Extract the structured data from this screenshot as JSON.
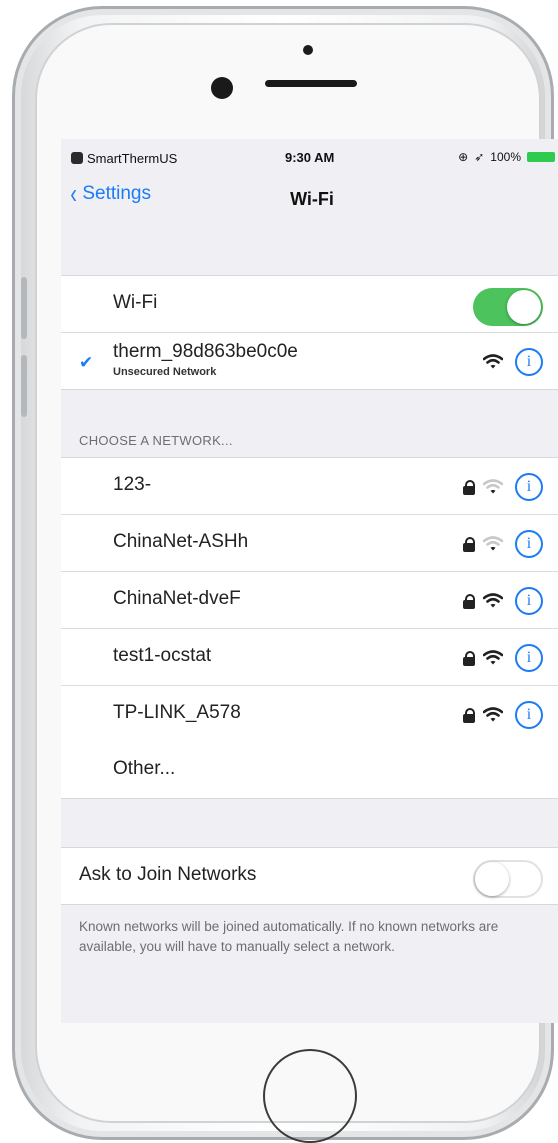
{
  "status_bar": {
    "carrier": "SmartThermUS",
    "time": "9:30 AM",
    "battery": "100%"
  },
  "nav": {
    "back_label": "Settings",
    "title": "Wi-Fi"
  },
  "wifi": {
    "label": "Wi-Fi",
    "enabled": true,
    "connected_network": "therm_98d863be0c0e",
    "connected_status": "Unsecured Network"
  },
  "networks": {
    "section_header": "CHOOSE A NETWORK...",
    "items": [
      {
        "name": "123-",
        "locked": true,
        "signal": 1
      },
      {
        "name": "ChinaNet-ASHh",
        "locked": true,
        "signal": 1
      },
      {
        "name": "ChinaNet-dveF",
        "locked": true,
        "signal": 3
      },
      {
        "name": "test1-ocstat",
        "locked": true,
        "signal": 3
      },
      {
        "name": "TP-LINK_A578",
        "locked": true,
        "signal": 3
      }
    ],
    "other_label": "Other..."
  },
  "ask_to_join": {
    "label": "Ask to Join Networks",
    "enabled": false,
    "footer": "Known networks will be joined automatically. If no known networks are available, you will have to manually select a network."
  },
  "icons": {
    "carrier": "app-icon",
    "back": "chevron-left-icon",
    "checkmark": "checkmark-icon",
    "lock": "lock-icon",
    "wifi": "wifi-signal-icon",
    "info": "info-icon"
  },
  "colors": {
    "accent": "#1c7cf4",
    "toggle_on": "#4cc35c",
    "battery": "#2ecb4f",
    "background": "#efeff4"
  }
}
